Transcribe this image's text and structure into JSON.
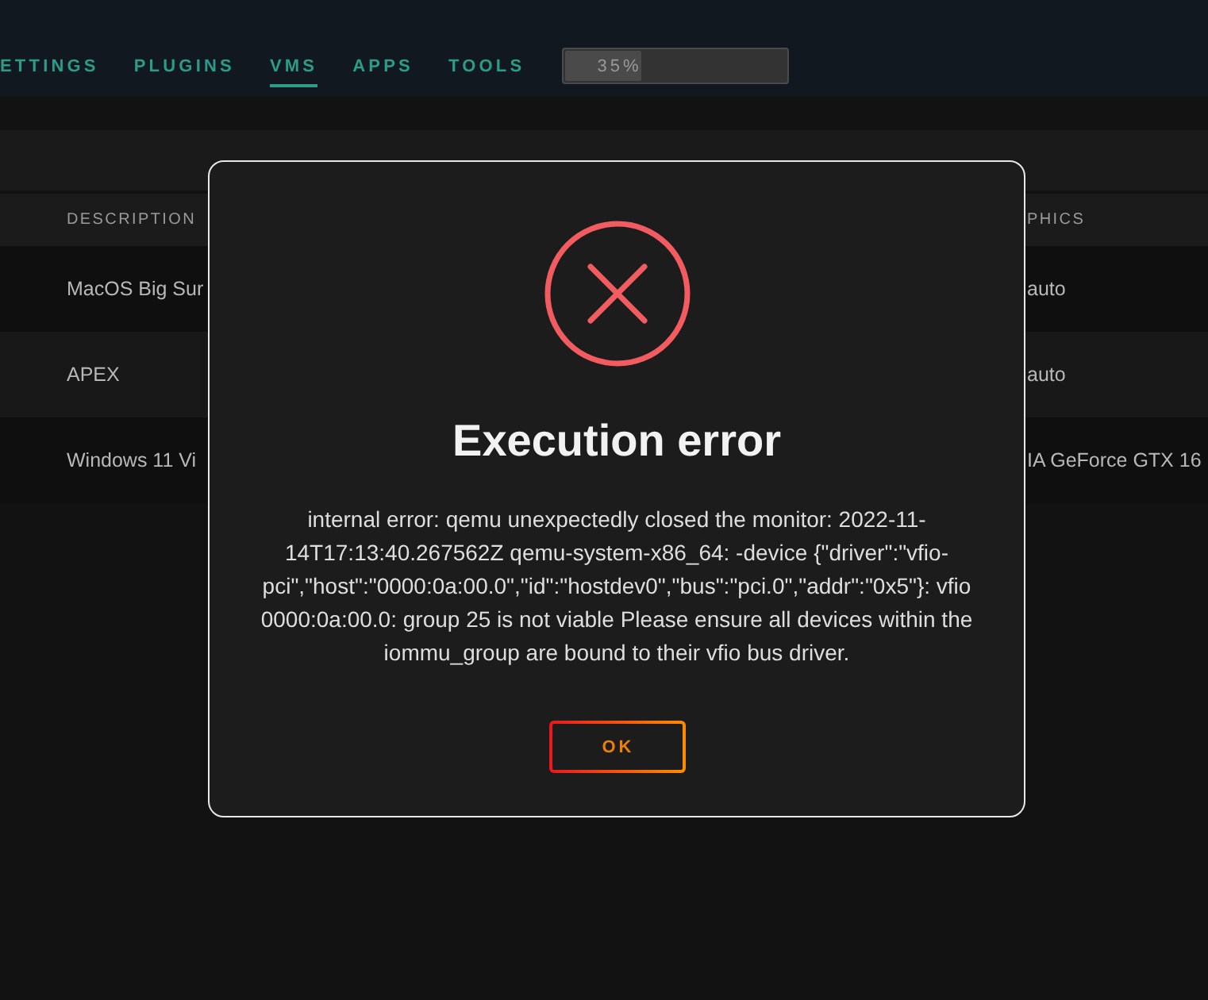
{
  "nav": {
    "tabs": [
      {
        "label": "ETTINGS",
        "selected": false
      },
      {
        "label": "PLUGINS",
        "selected": false
      },
      {
        "label": "VMS",
        "selected": true
      },
      {
        "label": "APPS",
        "selected": false
      },
      {
        "label": "TOOLS",
        "selected": false
      }
    ]
  },
  "progress": {
    "label": "35%",
    "level": 0.35
  },
  "table": {
    "columns": [
      "DESCRIPTION",
      "PHICS"
    ],
    "rows": [
      [
        "MacOS Big Sur",
        "auto"
      ],
      [
        "APEX",
        "auto"
      ],
      [
        "Windows 11 Vi",
        "IA GeForce GTX 16"
      ]
    ]
  },
  "dialog": {
    "title": "Execution error",
    "message": "internal error: qemu unexpectedly closed the monitor: 2022-11-14T17:13:40.267562Z qemu-system-x86_64: -device {\"driver\":\"vfio-pci\",\"host\":\"0000:0a:00.0\",\"id\":\"hostdev0\",\"bus\":\"pci.0\",\"addr\":\"0x5\"}: vfio 0000:0a:00.0: group 25 is not viable Please ensure all devices within the iommu_group are bound to their vfio bus driver.",
    "buttons": [
      "OK"
    ]
  }
}
